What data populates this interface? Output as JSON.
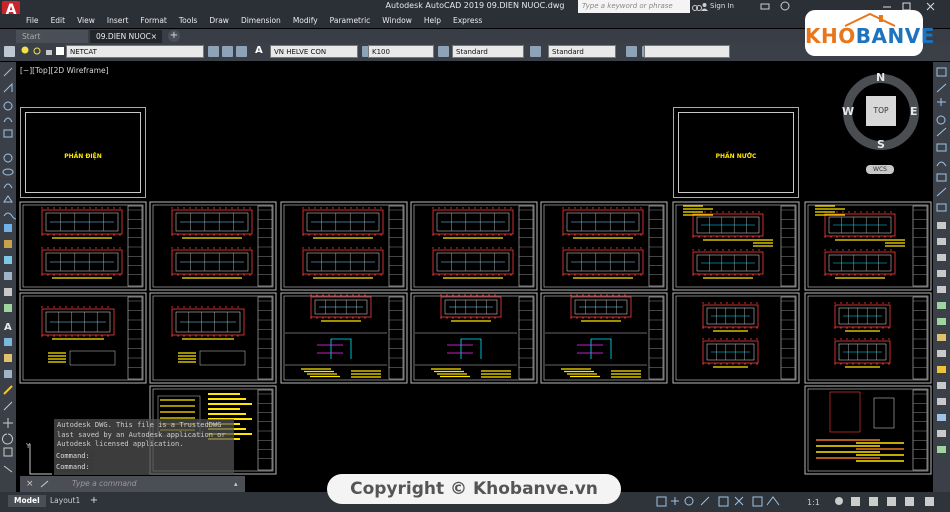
{
  "window": {
    "app_title": "Autodesk AutoCAD 2019    09.DIEN NUOC.dwg",
    "search_placeholder": "Type a keyword or phrase",
    "sign_in": "Sign In"
  },
  "menubar": [
    "File",
    "Edit",
    "View",
    "Insert",
    "Format",
    "Tools",
    "Draw",
    "Dimension",
    "Modify",
    "Parametric",
    "Window",
    "Help",
    "Express"
  ],
  "tabs": {
    "start": "Start",
    "active": "09.DIEN NUOC",
    "close": "×",
    "add": "+"
  },
  "toolbar": {
    "layer": "NETCAT",
    "text_style": "VN HELVE CON",
    "dim_style": "K100",
    "table_style": "Standard",
    "multileader_style": "Standard"
  },
  "viewport": {
    "label": "[−][Top][2D Wireframe]",
    "viewcube": {
      "top": "TOP",
      "n": "N",
      "s": "S",
      "e": "E",
      "w": "W",
      "wcs": "WCS"
    },
    "cover_sheets": [
      {
        "title": "PHẦN ĐIỆN"
      },
      {
        "title": "PHẦN NƯỚC"
      }
    ]
  },
  "command": {
    "history": [
      "Autodesk DWG.  This file is a TrustedDWG",
      "last saved by an Autodesk application or",
      "Autodesk licensed application."
    ],
    "prompt1": "Command:",
    "prompt2": "Command:",
    "placeholder": "Type a command"
  },
  "status": {
    "model_tab": "Model",
    "layout_tab": "Layout1",
    "add": "+",
    "scale": "1:1"
  },
  "watermark": {
    "copyright": "Copyright © Khobanve.vn",
    "logo": "KHOBANVE"
  },
  "colors": {
    "accent_red": "#c8262c",
    "logo_orange": "#e8771c",
    "logo_blue": "#1e73be",
    "yellow": "#ffe600",
    "cyan": "#00e5ff",
    "magenta": "#ff2cff"
  }
}
